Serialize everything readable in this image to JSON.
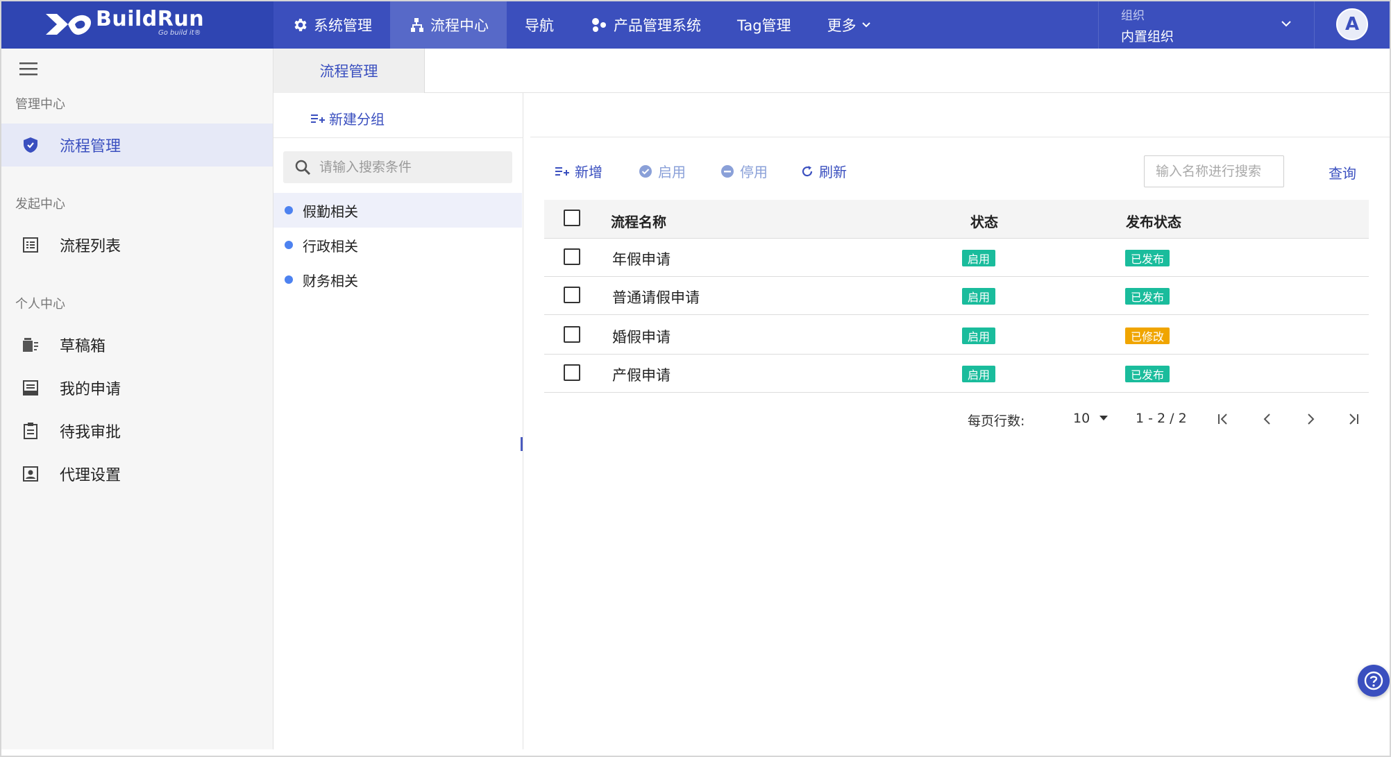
{
  "brand": {
    "name": "BuildRun",
    "tagline": "Go build it®"
  },
  "topnav": {
    "items": [
      {
        "label": "系统管理",
        "icon": "gear-icon"
      },
      {
        "label": "流程中心",
        "icon": "sitemap-icon"
      },
      {
        "label": "导航",
        "icon": ""
      },
      {
        "label": "产品管理系统",
        "icon": "cubes-icon"
      },
      {
        "label": "Tag管理",
        "icon": ""
      },
      {
        "label": "更多",
        "icon": "chevron-down-icon"
      }
    ],
    "org": {
      "label": "组织",
      "value": "内置组织"
    },
    "avatar": "A"
  },
  "sidebar": {
    "sections": [
      {
        "title": "管理中心",
        "items": [
          {
            "label": "流程管理",
            "icon": "shield-icon",
            "active": true
          }
        ]
      },
      {
        "title": "发起中心",
        "items": [
          {
            "label": "流程列表",
            "icon": "list-icon"
          }
        ]
      },
      {
        "title": "个人中心",
        "items": [
          {
            "label": "草稿箱",
            "icon": "drafts-icon"
          },
          {
            "label": "我的申请",
            "icon": "inbox-icon"
          },
          {
            "label": "待我审批",
            "icon": "clipboard-icon"
          },
          {
            "label": "代理设置",
            "icon": "contact-icon"
          }
        ]
      }
    ]
  },
  "tabs": [
    {
      "label": "流程管理"
    }
  ],
  "groups": {
    "new_label": "新建分组",
    "search_placeholder": "请输入搜索条件",
    "items": [
      "假勤相关",
      "行政相关",
      "财务相关"
    ]
  },
  "toolbar": {
    "add": "新增",
    "enable": "启用",
    "disable": "停用",
    "refresh": "刷新",
    "search_placeholder": "输入名称进行搜索",
    "query": "查询"
  },
  "table": {
    "columns": [
      "流程名称",
      "状态",
      "发布状态"
    ],
    "rows": [
      {
        "name": "年假申请",
        "status": "启用",
        "publish": "已发布",
        "publish_color": "#1abc9c"
      },
      {
        "name": "普通请假申请",
        "status": "启用",
        "publish": "已发布",
        "publish_color": "#1abc9c"
      },
      {
        "name": "婚假申请",
        "status": "启用",
        "publish": "已修改",
        "publish_color": "#f0a500"
      },
      {
        "name": "产假申请",
        "status": "启用",
        "publish": "已发布",
        "publish_color": "#1abc9c"
      }
    ]
  },
  "pagination": {
    "rows_label": "每页行数:",
    "page_size": "10",
    "range": "1 - 2 / 2"
  },
  "colors": {
    "header": "#3b4fbd",
    "accent": "#3a4fbf",
    "success": "#1abc9c",
    "warning": "#f0a500"
  }
}
